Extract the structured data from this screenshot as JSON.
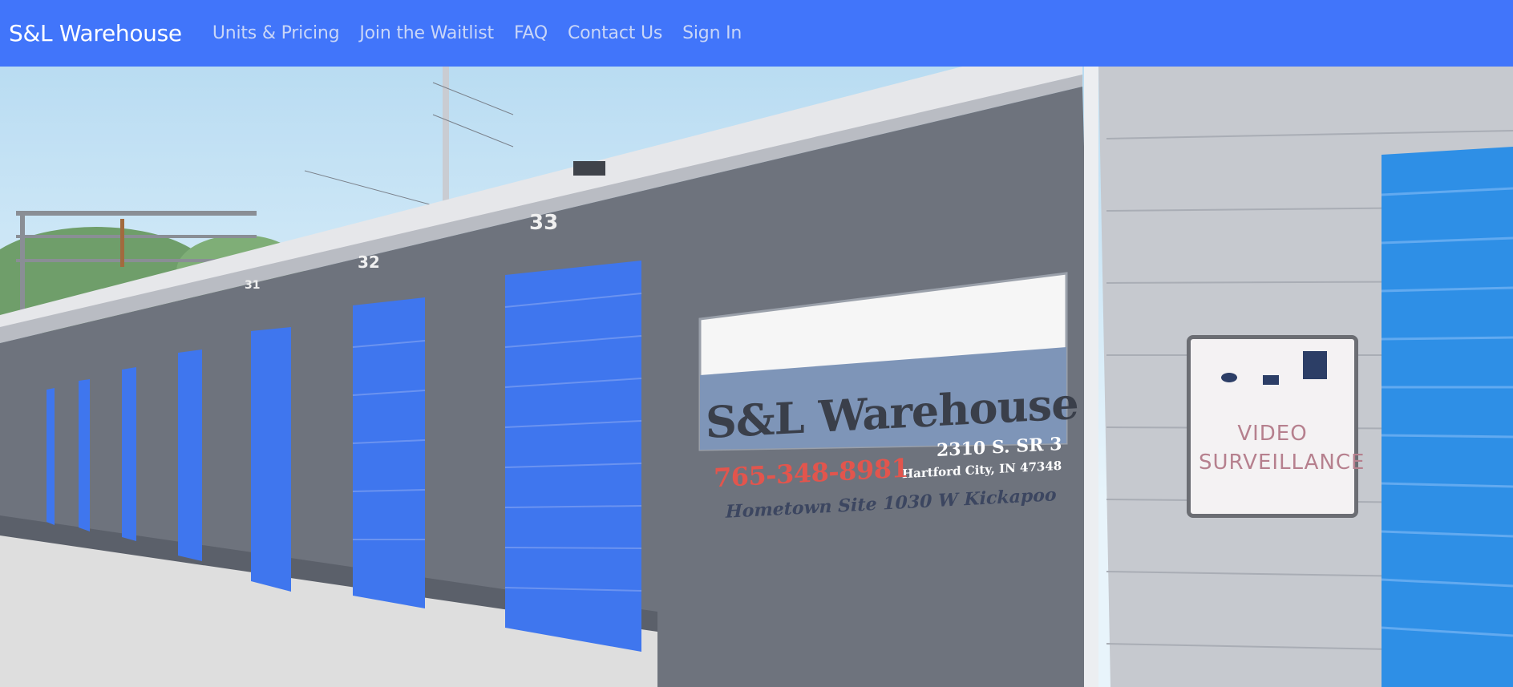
{
  "navbar": {
    "brand": "S&L Warehouse",
    "links": [
      "Units & Pricing",
      "Join the Waitlist",
      "FAQ",
      "Contact Us",
      "Sign In"
    ]
  },
  "hero": {
    "sign": {
      "title": "S&L Warehouse",
      "address": "2310 S. SR 3",
      "city": "Hartford City, IN 47348",
      "phone": "765-348-8981",
      "hometown": "Hometown Site 1030 W Kickapoo"
    },
    "video_sign": {
      "line1": "VIDEO",
      "line2": "SURVEILLANCE"
    },
    "unit_numbers": [
      "33",
      "32",
      "31"
    ]
  },
  "colors": {
    "navbar": "#4175fa",
    "door_blue": "#3f76ee",
    "wall_gray": "#6e737d"
  }
}
